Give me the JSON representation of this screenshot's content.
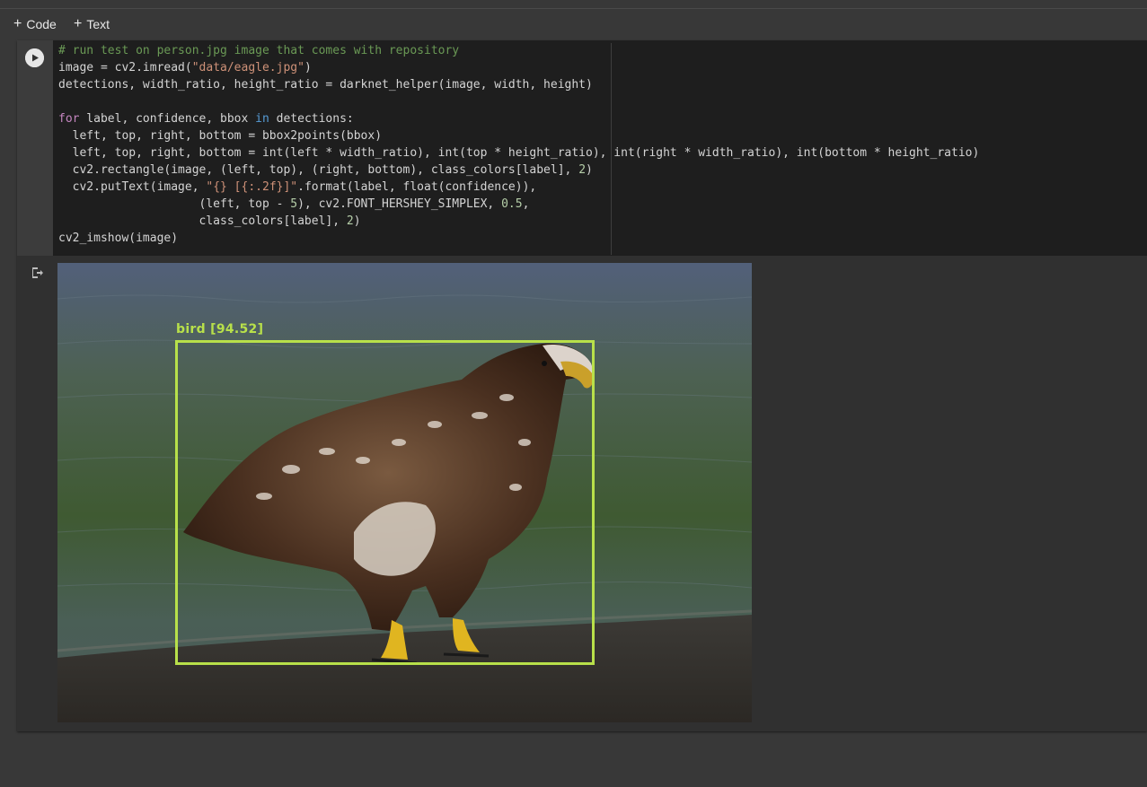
{
  "toolbar": {
    "code_label": "Code",
    "text_label": "Text",
    "plus_icon": "plus-icon"
  },
  "cell": {
    "run_icon": "play-icon",
    "output_icon": "output-redirect-icon",
    "code_lines": [
      "# run test on person.jpg image that comes with repository",
      "image = cv2.imread(\"data/eagle.jpg\")",
      "detections, width_ratio, height_ratio = darknet_helper(image, width, height)",
      "",
      "for label, confidence, bbox in detections:",
      "  left, top, right, bottom = bbox2points(bbox)",
      "  left, top, right, bottom = int(left * width_ratio), int(top * height_ratio), int(right * width_ratio), int(bottom * height_ratio)",
      "  cv2.rectangle(image, (left, top), (right, bottom), class_colors[label], 2)",
      "  cv2.putText(image, \"{} [{:.2f}]\".format(label, float(confidence)),",
      "                    (left, top - 5), cv2.FONT_HERSHEY_SIMPLEX, 0.5,",
      "                    class_colors[label], 2)",
      "cv2_imshow(image)"
    ]
  },
  "output": {
    "detection_label": "bird [94.52]",
    "box_color": "#b8e04a"
  },
  "colors": {
    "background": "#383838",
    "editor_bg": "#1e1e1e",
    "comment": "#6a9955",
    "string": "#ce9178",
    "keyword": "#c586c0"
  }
}
